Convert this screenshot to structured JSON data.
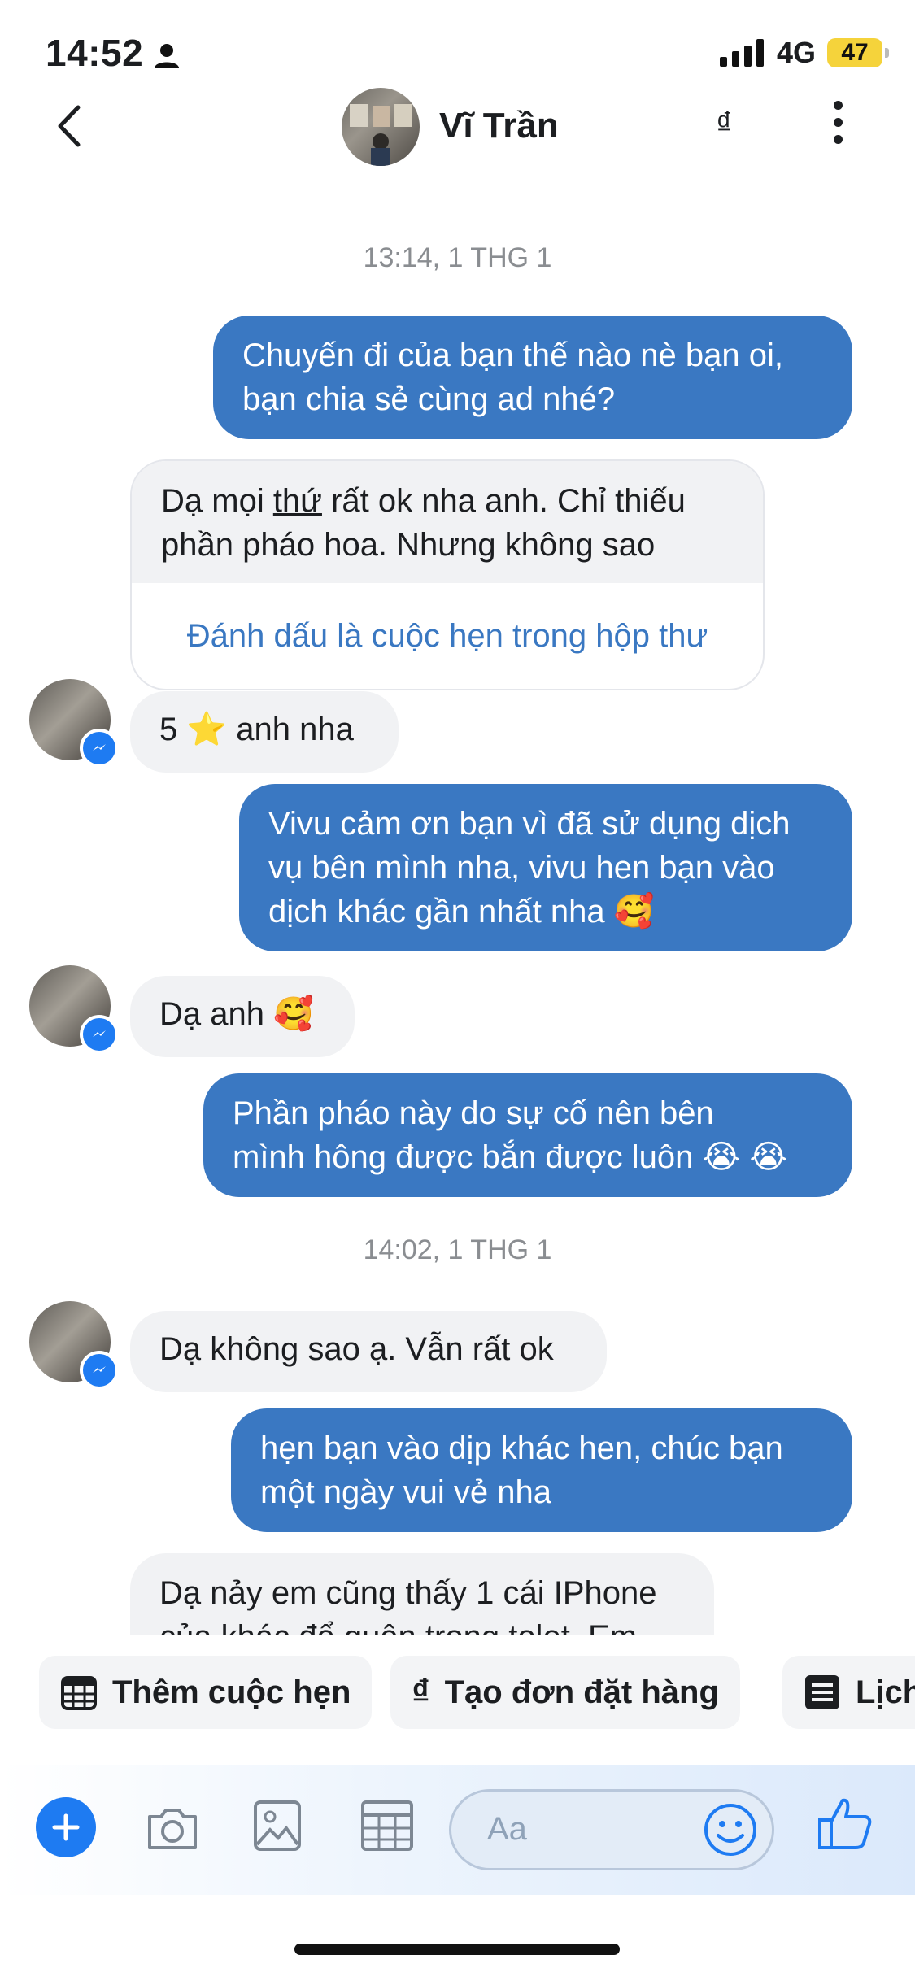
{
  "status_bar": {
    "time": "14:52",
    "network": "4G",
    "battery": "47"
  },
  "header": {
    "name": "Vĩ Trần",
    "currency_symbol": "₫"
  },
  "colors": {
    "outgoing_bubble": "#3a78c2",
    "incoming_bubble": "#f1f2f4",
    "accent": "#1e7bf2",
    "battery": "#f5d33b"
  },
  "messages": {
    "ts1": "13:14, 1 THG 1",
    "m1_line1": "Chuyến đi của bạn thế nào nè bạn oi,",
    "m1_line2": "bạn chia sẻ cùng ad nhé?",
    "m2_line1_pre": "Dạ mọi ",
    "m2_line1_u": "thứ",
    "m2_line1_post": " rất ok nha anh. Chỉ thiếu",
    "m2_line2": "phần pháo hoa. Nhưng không sao",
    "m2_action": "Đánh dấu là cuộc hẹn trong hộp thư",
    "m3_pre": "5 ",
    "m3_emoji": "⭐",
    "m3_post": " anh nha",
    "m4_line1": "Vivu cảm ơn bạn vì đã sử dụng dịch",
    "m4_line2": "vụ bên mình nha, vivu hen bạn vào",
    "m4_line3": "dịch khác gần nhất nha",
    "m4_emoji": "🥰",
    "m5_text": "Dạ anh",
    "m5_emoji": "🥰",
    "m6_line1": "Phần pháo này do sự cố nên bên",
    "m6_line2": "mình hông được bắn được luôn",
    "m6_emoji": "😭 😭",
    "ts2": "14:02, 1 THG 1",
    "m7_text": "Dạ không sao ạ. Vẫn rất ok",
    "m8_line1": "hẹn bạn vào dịp khác hen, chúc bạn",
    "m8_line2": "một ngày vui vẻ nha",
    "m9_line1": "Dạ nảy em cũng thấy 1 cái IPhone",
    "m9_line2": "của khác để quên trong tolet. Em"
  },
  "quick_replies": {
    "add_appointment": "Thêm cuộc hẹn",
    "create_order": "Tạo đơn đặt hàng",
    "calendar": "Lịch"
  },
  "composer": {
    "placeholder": "Aa"
  },
  "icons": [
    "person-icon",
    "signal-icon",
    "back-chevron-icon",
    "currency-icon",
    "more-vertical-icon",
    "messenger-badge-icon",
    "calendar-icon",
    "list-icon",
    "plus-icon",
    "camera-icon",
    "image-icon",
    "table-icon",
    "smiley-icon",
    "thumbs-up-icon"
  ]
}
